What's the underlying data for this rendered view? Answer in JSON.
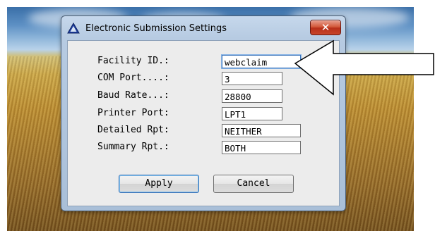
{
  "window": {
    "title": "Electronic Submission Settings",
    "close_glyph": "✕"
  },
  "form": {
    "fields": [
      {
        "label": "Facility ID.:",
        "value": "webclaim"
      },
      {
        "label": "COM Port....:",
        "value": "3"
      },
      {
        "label": "Baud Rate...:",
        "value": "28800"
      },
      {
        "label": "Printer Port:",
        "value": "LPT1"
      },
      {
        "label": "Detailed Rpt:",
        "value": "NEITHER"
      },
      {
        "label": "Summary Rpt.:",
        "value": "BOTH"
      }
    ]
  },
  "buttons": {
    "apply_label": "Apply",
    "cancel_label": "Cancel"
  },
  "icons": {
    "title": "warning-triangle-icon",
    "close": "close-icon",
    "callout": "arrow-left-icon"
  },
  "colors": {
    "titlebar": "#b7cbe2",
    "close_button": "#c8452a",
    "client_bg": "#ececec",
    "focus": "#3b74b8"
  }
}
